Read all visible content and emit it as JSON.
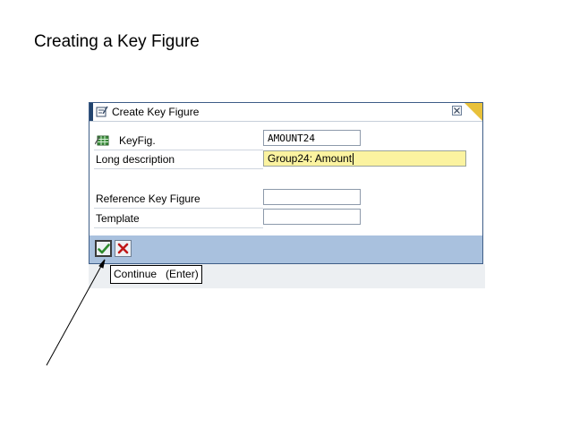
{
  "slide": {
    "title": "Creating a Key Figure"
  },
  "dialog": {
    "title": "Create Key Figure",
    "fields": {
      "keyfig_label": "KeyFig.",
      "keyfig_value": "AMOUNT24",
      "long_description_label": "Long description",
      "long_description_value": "Group24: Amount",
      "reference_label": "Reference Key Figure",
      "reference_value": "",
      "template_label": "Template",
      "template_value": ""
    },
    "tooltip": "Continue   (Enter)"
  },
  "icons": {
    "title": "create-dialog-icon",
    "keyfig": "table-icon",
    "close": "close-icon",
    "continue": "checkmark-icon",
    "cancel": "cancel-x-icon"
  },
  "colors": {
    "title_accent": "#22446e",
    "footer": "#a9c1de",
    "focused_field": "#fbf3a0",
    "check": "#2e8b2e",
    "cancel": "#c01818"
  }
}
